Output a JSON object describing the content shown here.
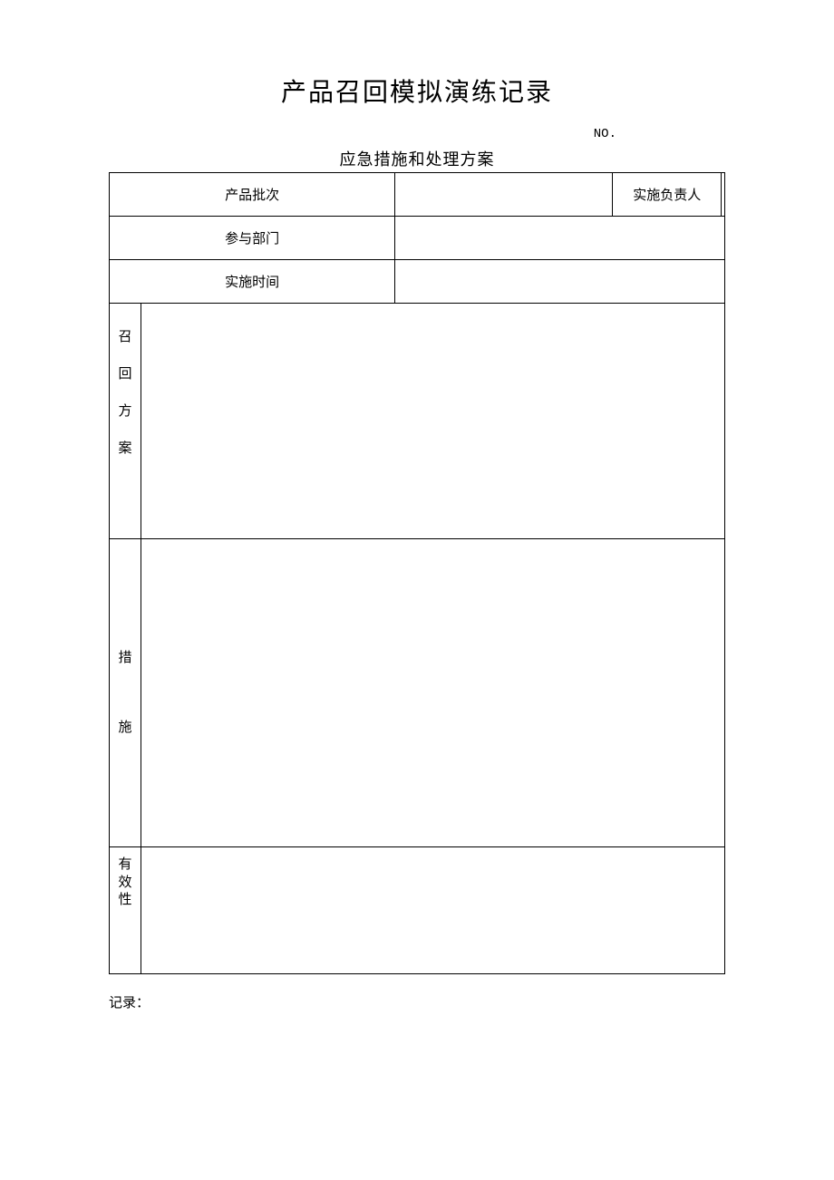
{
  "title": "产品召回模拟演练记录",
  "doc_no_label": "NO.",
  "subtitle": "应急措施和处理方案",
  "labels": {
    "product_batch": "产品批次",
    "responsible_person": "实施负责人",
    "departments": "参与部门",
    "implementation_time": "实施时间",
    "recall_plan_c1": "召",
    "recall_plan_c2": "回",
    "recall_plan_c3": "方",
    "recall_plan_c4": "案",
    "measure_c1": "措",
    "measure_c2": "施",
    "effect_c1": "有",
    "effect_c2": "效",
    "effect_c3": "性"
  },
  "values": {
    "product_batch": "",
    "responsible_person": "",
    "departments": "",
    "implementation_time": "",
    "recall_plan": "",
    "measure": "",
    "effectiveness": ""
  },
  "footer": "记录："
}
